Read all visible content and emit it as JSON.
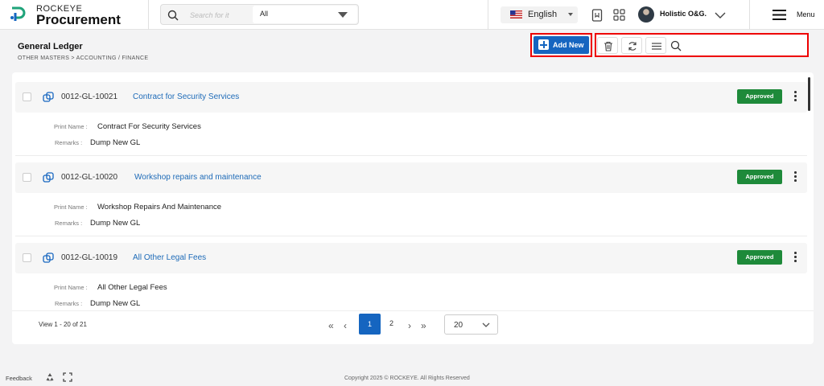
{
  "app": {
    "brand_small": "ROCKEYE",
    "brand_main": "Procurement"
  },
  "search": {
    "placeholder": "Search for it",
    "scope": "All"
  },
  "language": {
    "label": "English"
  },
  "user": {
    "name": "Holistic O&G."
  },
  "menu": {
    "label": "Menu"
  },
  "page": {
    "title": "General Ledger",
    "breadcrumb": "OTHER MASTERS >  ACCOUNTING / FINANCE"
  },
  "toolbar": {
    "add_label": "Add New",
    "search_placeholder": ""
  },
  "fields": {
    "print_name_label": "Print Name :",
    "remarks_label": "Remarks :"
  },
  "records": [
    {
      "code": "0012-GL-10021",
      "title": "Contract for Security Services",
      "status": "Approved",
      "print_name": "Contract For Security Services",
      "remarks": "Dump New GL"
    },
    {
      "code": "0012-GL-10020",
      "title": "Workshop repairs and maintenance",
      "status": "Approved",
      "print_name": "Workshop Repairs And Maintenance",
      "remarks": "Dump New GL"
    },
    {
      "code": "0012-GL-10019",
      "title": "All Other Legal Fees",
      "status": "Approved",
      "print_name": "All Other Legal Fees",
      "remarks": "Dump New GL"
    }
  ],
  "pagination": {
    "view_text": "View 1 - 20 of 21",
    "current_page": "1",
    "next_page": "2",
    "per_page": "20"
  },
  "footer": {
    "feedback": "Feedback",
    "copyright": "Copyright 2025 © ROCKEYE. All Rights Reserved"
  },
  "colors": {
    "primary": "#1565c0",
    "approved": "#1e8a3a",
    "link": "#1e6bb8",
    "highlight": "#e00000"
  }
}
